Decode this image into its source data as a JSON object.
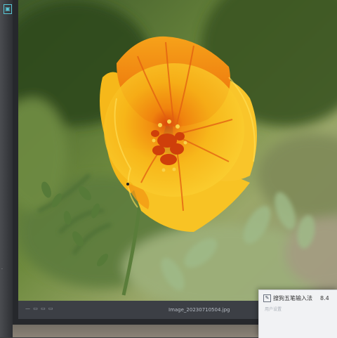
{
  "left_panel": {
    "top_icon": "image-icon",
    "bottom_label": "."
  },
  "photo": {
    "subject": "orange-yellow poppy flower"
  },
  "status_bar": {
    "left_text": "— ▭ ▭ ▭",
    "filename": "Image_20230710504.jpg"
  },
  "ime_popup": {
    "icon": "edit-icon",
    "title": "搜狗五笔输入法",
    "version": "8.4",
    "subtitle": "用户设置"
  },
  "colors": {
    "accent_icon": "#58c8d8",
    "petal_outer": "#f7c21a",
    "petal_inner": "#ef7a0d",
    "petal_center": "#d84a0a",
    "background_green": "#4f6a2f"
  }
}
